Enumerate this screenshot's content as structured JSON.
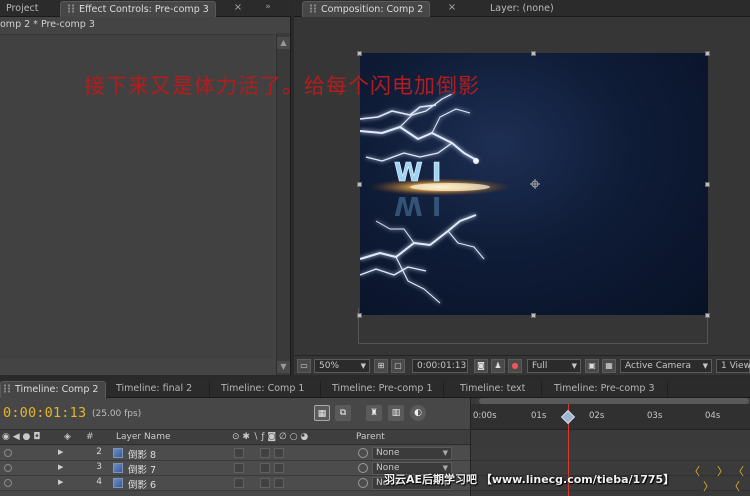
{
  "panels_top": {
    "project_tab": "Project",
    "effect_controls_tab": "Effect Controls: Pre-comp 3",
    "composition_tab": "Composition: Comp 2",
    "layer_tab": "Layer: (none)"
  },
  "effect_controls": {
    "path": "omp 2 * Pre-comp 3"
  },
  "caption": "接下来又是体力活了。给每个闪电加倒影",
  "composition": {
    "title_text": "W I"
  },
  "comp_bar": {
    "zoom": "50%",
    "timecode": "0:00:01:13",
    "resolution": "Full",
    "camera": "Active Camera",
    "view": "1 View"
  },
  "timeline_tabs": [
    {
      "label": "Timeline: Comp 2",
      "active": true
    },
    {
      "label": "Timeline: final 2",
      "active": false
    },
    {
      "label": "Timeline: Comp 1",
      "active": false
    },
    {
      "label": "Timeline: Pre-comp 1",
      "active": false
    },
    {
      "label": "Timeline: text",
      "active": false
    },
    {
      "label": "Timeline: Pre-comp 3",
      "active": false
    }
  ],
  "timeline": {
    "current_time": "0:00:01:13",
    "fps": "(25.00 fps)",
    "columns": {
      "number": "#",
      "layer_name": "Layer Name",
      "parent": "Parent"
    },
    "ruler_ticks": [
      "0:00s",
      "01s",
      "02s",
      "03s",
      "04s"
    ],
    "layers": [
      {
        "number": "2",
        "name": "倒影 8",
        "parent": "None"
      },
      {
        "number": "3",
        "name": "倒影 7",
        "parent": "None"
      },
      {
        "number": "4",
        "name": "倒影 6",
        "parent": "None"
      }
    ]
  },
  "watermark": "羽云AE后期学习吧 【www.linecg.com/tieba/1775】",
  "colors": {
    "timecode": "#e6b526",
    "caption": "#b31d1d",
    "playhead": "#d83a2c",
    "comp_bg": "#0f1c37"
  }
}
